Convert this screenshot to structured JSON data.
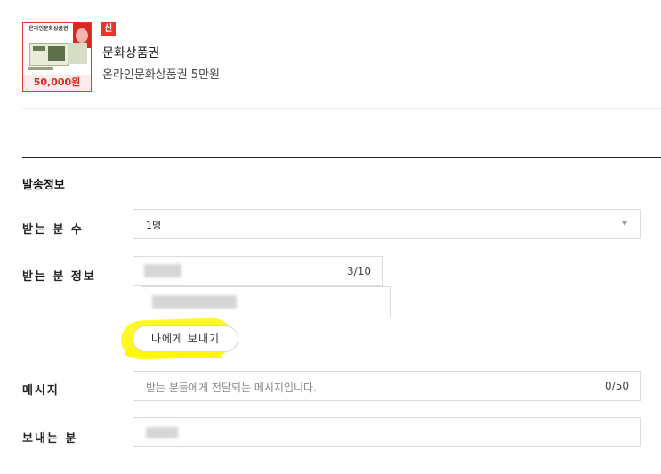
{
  "product": {
    "thumbnail_header": "온라인문화상품권",
    "thumbnail_price": "50,000원",
    "badge": "신세계몰",
    "name": "문화상품권",
    "description": "온라인문화상품권 5만원"
  },
  "form": {
    "section_title": "발송정보",
    "recipient_count": {
      "label": "받는 분 수",
      "selected": "1명"
    },
    "recipient_info": {
      "label": "받는 분 정보",
      "name_counter": "3/10"
    },
    "send_to_me_button": "나에게 보내기",
    "message": {
      "label": "메시지",
      "placeholder": "받는 분들에게 전달되는 메시지입니다.",
      "counter": "0/50"
    },
    "sender": {
      "label": "보내는 분"
    }
  },
  "colors": {
    "accent_red": "#e9362b",
    "highlight_yellow": "#fff700"
  }
}
